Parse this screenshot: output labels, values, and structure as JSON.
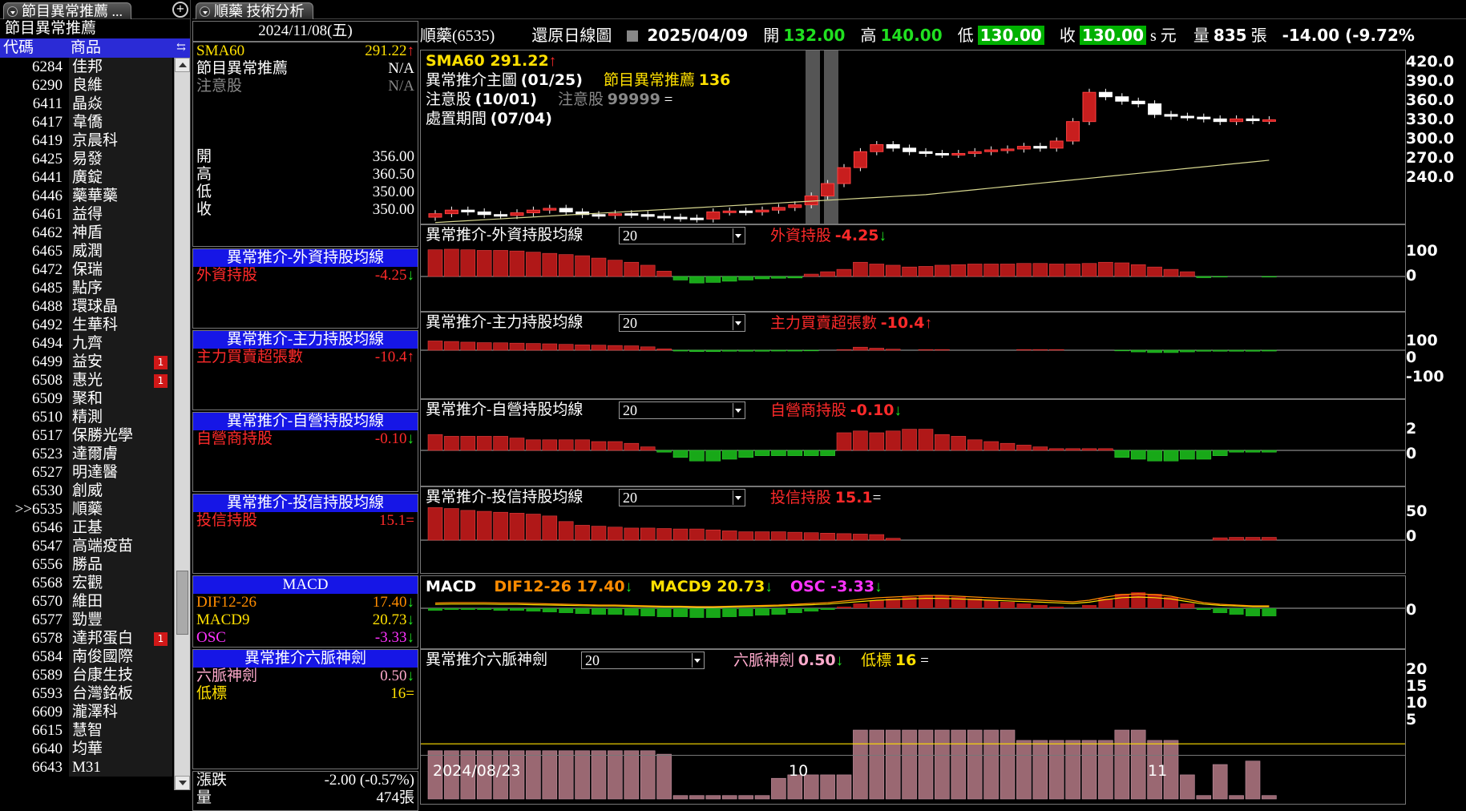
{
  "left_panel": {
    "tab_title": "節目異常推薦 ...",
    "subtitle": "節目異常推薦",
    "col_code": "代碼",
    "col_name": "商品",
    "rows": [
      {
        "code": "6284",
        "name": "佳邦",
        "badge": ""
      },
      {
        "code": "6290",
        "name": "良維",
        "badge": ""
      },
      {
        "code": "6411",
        "name": "晶焱",
        "badge": ""
      },
      {
        "code": "6417",
        "name": "韋僑",
        "badge": ""
      },
      {
        "code": "6419",
        "name": "京晨科",
        "badge": ""
      },
      {
        "code": "6425",
        "name": "易發",
        "badge": ""
      },
      {
        "code": "6441",
        "name": "廣錠",
        "badge": ""
      },
      {
        "code": "6446",
        "name": "藥華藥",
        "badge": ""
      },
      {
        "code": "6461",
        "name": "益得",
        "badge": ""
      },
      {
        "code": "6462",
        "name": "神盾",
        "badge": ""
      },
      {
        "code": "6465",
        "name": "威潤",
        "badge": ""
      },
      {
        "code": "6472",
        "name": "保瑞",
        "badge": ""
      },
      {
        "code": "6485",
        "name": "點序",
        "badge": ""
      },
      {
        "code": "6488",
        "name": "環球晶",
        "badge": ""
      },
      {
        "code": "6492",
        "name": "生華科",
        "badge": ""
      },
      {
        "code": "6494",
        "name": "九齊",
        "badge": ""
      },
      {
        "code": "6499",
        "name": "益安",
        "badge": "1"
      },
      {
        "code": "6508",
        "name": "惠光",
        "badge": "1"
      },
      {
        "code": "6509",
        "name": "聚和",
        "badge": ""
      },
      {
        "code": "6510",
        "name": "精測",
        "badge": ""
      },
      {
        "code": "6517",
        "name": "保勝光學",
        "badge": ""
      },
      {
        "code": "6523",
        "name": "達爾膚",
        "badge": ""
      },
      {
        "code": "6527",
        "name": "明達醫",
        "badge": ""
      },
      {
        "code": "6530",
        "name": "創威",
        "badge": ""
      },
      {
        "code": ">>6535",
        "name": "順藥",
        "badge": ""
      },
      {
        "code": "6546",
        "name": "正基",
        "badge": ""
      },
      {
        "code": "6547",
        "name": "高端疫苗",
        "badge": ""
      },
      {
        "code": "6556",
        "name": "勝品",
        "badge": ""
      },
      {
        "code": "6568",
        "name": "宏觀",
        "badge": ""
      },
      {
        "code": "6570",
        "name": "維田",
        "badge": ""
      },
      {
        "code": "6577",
        "name": "勁豐",
        "badge": ""
      },
      {
        "code": "6578",
        "name": "達邦蛋白",
        "badge": "1"
      },
      {
        "code": "6584",
        "name": "南俊國際",
        "badge": ""
      },
      {
        "code": "6589",
        "name": "台康生技",
        "badge": ""
      },
      {
        "code": "6593",
        "name": "台灣銘板",
        "badge": ""
      },
      {
        "code": "6609",
        "name": "瀧澤科",
        "badge": ""
      },
      {
        "code": "6615",
        "name": "慧智",
        "badge": ""
      },
      {
        "code": "6640",
        "name": "均華",
        "badge": ""
      },
      {
        "code": "6643",
        "name": "M31",
        "badge": ""
      }
    ]
  },
  "main_tab": "順藥 技術分析",
  "info": {
    "date": "2024/11/08(五)",
    "sma_label": "SMA60",
    "sma_val": "291.22",
    "rec_label": "節目異常推薦",
    "rec_val": "N/A",
    "att_label": "注意股",
    "att_val": "N/A",
    "ohlc": [
      {
        "k": "開",
        "v": "356.00"
      },
      {
        "k": "高",
        "v": "360.50"
      },
      {
        "k": "低",
        "v": "350.00"
      },
      {
        "k": "收",
        "v": "350.00"
      }
    ],
    "boxes": [
      {
        "title": "異常推介-外資持股均線",
        "label": "外資持股",
        "val": "-4.25"
      },
      {
        "title": "異常推介-主力持股均線",
        "label": "主力買賣超張數",
        "val": "-10.4"
      },
      {
        "title": "異常推介-自營持股均線",
        "label": "自營商持股",
        "val": "-0.10"
      },
      {
        "title": "異常推介-投信持股均線",
        "label": "投信持股",
        "val": "15.1"
      }
    ],
    "macd_title": "MACD",
    "dif_label": "DIF12-26",
    "dif_val": "17.40",
    "macd9_label": "MACD9",
    "macd9_val": "20.73",
    "osc_label": "OSC",
    "osc_val": "-3.33",
    "six_title": "異常推介六脈神劍",
    "six_label": "六脈神劍",
    "six_val": "0.50",
    "low_label": "低標",
    "low_val": "16",
    "chg_label": "漲跌",
    "chg_val": "-2.00 (-0.57%)",
    "vol_label": "量",
    "vol_val": "474張"
  },
  "topbar": {
    "stock": "順藥(6535)",
    "mode": "還原日線圖",
    "date": "2025/04/09",
    "open_label": "開",
    "open": "132.00",
    "high_label": "高",
    "high": "140.00",
    "low_label": "低",
    "low": "130.00",
    "close_label": "收",
    "close": "130.00",
    "unit": "s 元",
    "vol_label": "量",
    "vol": "835",
    "vol_unit": "張",
    "chg": "-14.00 (-9.72%"
  },
  "main_chart": {
    "title": "異常推介主圖",
    "title_date": "(01/25)",
    "sub": "節目異常推薦",
    "sub_val": "136",
    "att": "注意股",
    "att_date": "(10/01)",
    "att2": "注意股",
    "att2_val": "99999",
    "disp": "處置期間",
    "disp_date": "(07/04)",
    "sma_text": "SMA60 291.22",
    "yticks": [
      "420.0",
      "390.0",
      "360.0",
      "330.0",
      "300.0",
      "270.0",
      "240.0"
    ]
  },
  "panels": [
    {
      "title": "異常推介-外資持股均線",
      "sel": "20",
      "ind": "外資持股",
      "ind_val": "-4.25",
      "yticks": [
        "100",
        "0"
      ]
    },
    {
      "title": "異常推介-主力持股均線",
      "sel": "20",
      "ind": "主力買賣超張數",
      "ind_val": "-10.4",
      "yticks": [
        "100",
        "0",
        "-100"
      ]
    },
    {
      "title": "異常推介-自營持股均線",
      "sel": "20",
      "ind": "自營商持股",
      "ind_val": "-0.10",
      "yticks": [
        "2",
        "0"
      ]
    },
    {
      "title": "異常推介-投信持股均線",
      "sel": "20",
      "ind": "投信持股",
      "ind_val": "15.1",
      "yticks": [
        "50",
        "0"
      ]
    }
  ],
  "macd_panel": {
    "title": "MACD",
    "dif": "DIF12-26 17.40",
    "macd9": "MACD9 20.73",
    "osc": "OSC -3.33",
    "ytick": "0"
  },
  "six_panel": {
    "title": "異常推介六脈神劍",
    "sel": "20",
    "ind": "六脈神劍",
    "ind_val": "0.50",
    "low": "低標",
    "low_val": "16",
    "yticks": [
      "20",
      "15",
      "10",
      "5"
    ]
  },
  "xaxis": {
    "labels": [
      "2024/08/23",
      "10",
      "11"
    ]
  },
  "colors": {
    "up": "#c81e1e",
    "down": "#20c020",
    "panel_border": "#777",
    "title_bar": "#1616e6"
  }
}
